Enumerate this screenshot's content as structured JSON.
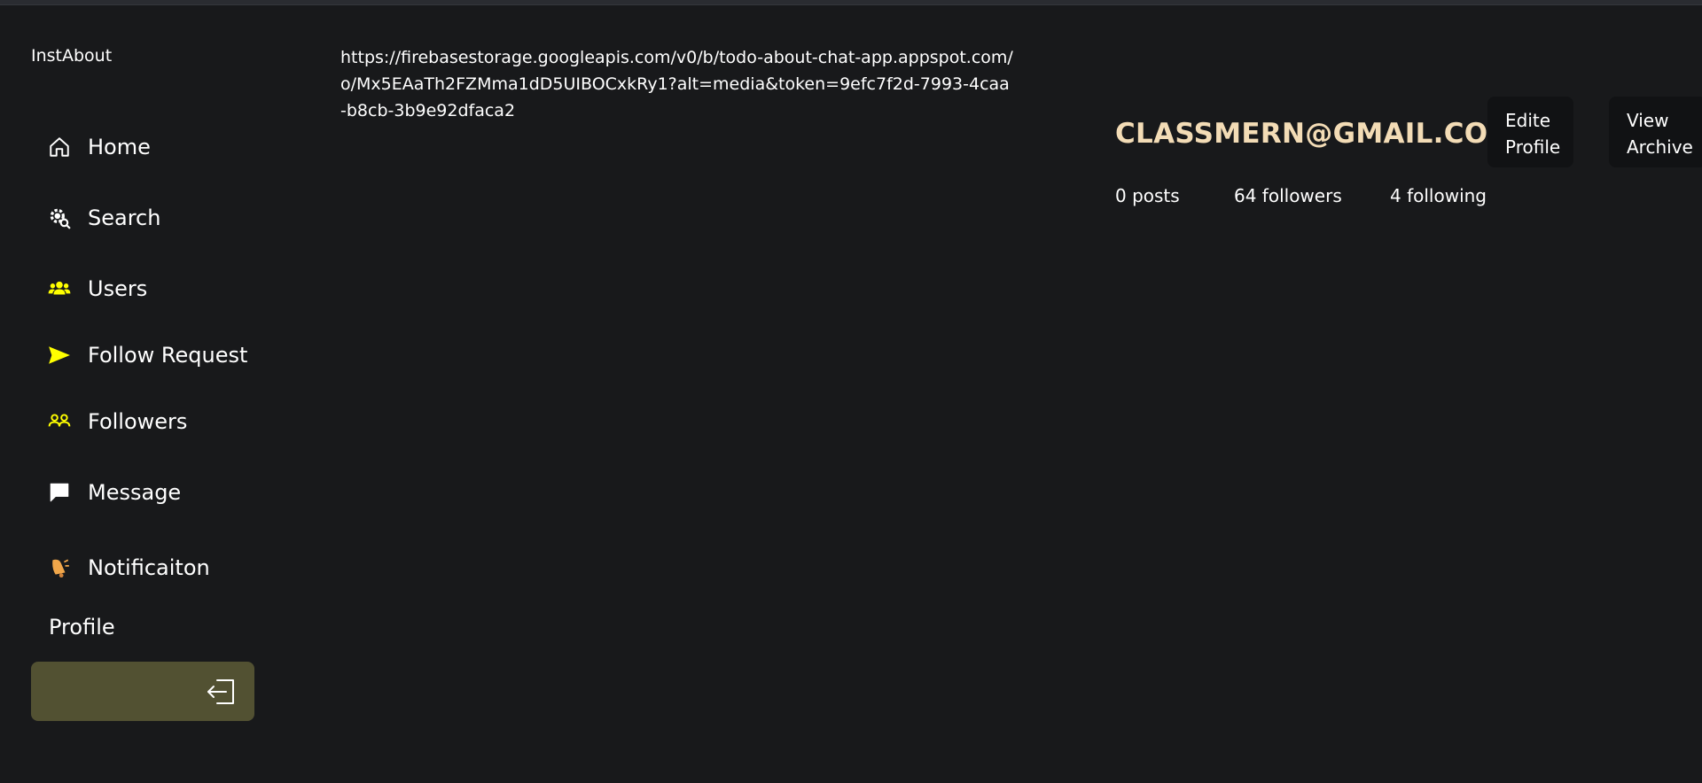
{
  "app": {
    "brand": "InstAbout"
  },
  "sidebar": {
    "items": [
      {
        "label": "Home",
        "icon": "home-icon"
      },
      {
        "label": "Search",
        "icon": "search-gear-icon"
      },
      {
        "label": "Users",
        "icon": "users-icon"
      },
      {
        "label": "Follow Request",
        "icon": "send-icon"
      },
      {
        "label": "Followers",
        "icon": "followers-icon"
      },
      {
        "label": "Message",
        "icon": "message-icon"
      },
      {
        "label": "Notificaiton",
        "icon": "notification-icon"
      }
    ],
    "profile_label": "Profile",
    "logout_icon": "logout-icon"
  },
  "main": {
    "image_url_text": "https://firebasestorage.googleapis.com/v0/b/todo-about-chat-app.appspot.com/o/Mx5EAaTh2FZMma1dD5UIBOCxkRy1?alt=media&token=9efc7f2d-7993-4caa-b8cb-3b9e92dfaca2"
  },
  "profile": {
    "username": "CLASSMERN@GMAIL.COM",
    "edit_button": "Edite Profile",
    "archive_button": "View Archive",
    "stats": {
      "posts": "0 posts",
      "followers": "64 followers",
      "following": "4 following"
    }
  },
  "colors": {
    "background": "#18191b",
    "accent_yellow": "#ffff00",
    "username": "#f3dcb6",
    "logout_bg": "#525132"
  }
}
